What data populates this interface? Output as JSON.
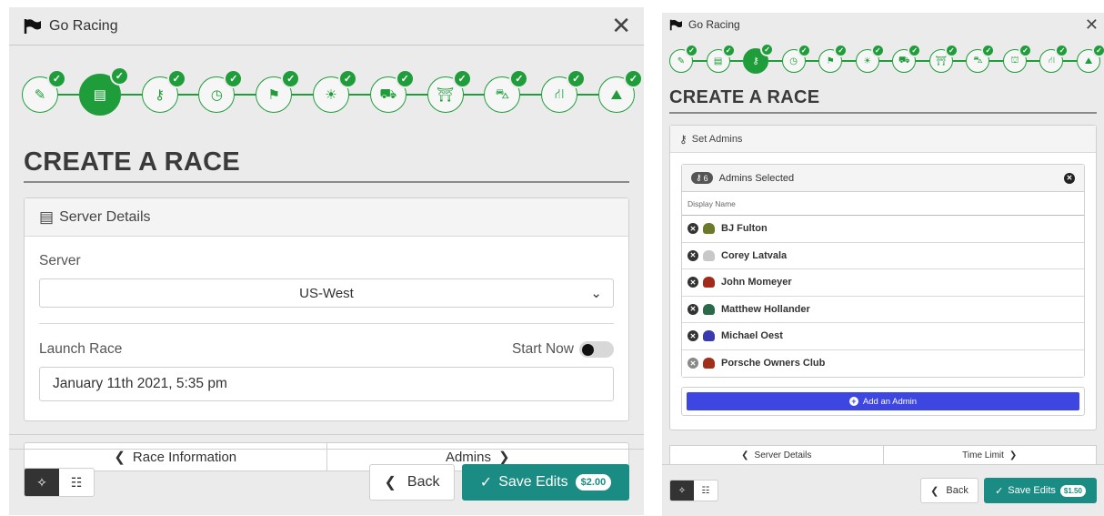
{
  "colors": {
    "green": "#1f9d3a",
    "teal": "#1a8c83",
    "blue": "#3d46e0"
  },
  "left": {
    "app_title": "Go Racing",
    "close": "✕",
    "heading": "CREATE A RACE",
    "card_title": "Server Details",
    "server_label": "Server",
    "server_value": "US-West",
    "launch_label": "Launch Race",
    "start_now_label": "Start Now",
    "start_now_on": false,
    "launch_value": "January 11th 2021, 5:35 pm",
    "nav_prev": "Race Information",
    "nav_next": "Admins",
    "back_label": "Back",
    "save_label": "Save Edits",
    "price": "$2.00",
    "steps": [
      {
        "icon": "pencil-icon",
        "glyph": "✎"
      },
      {
        "icon": "server-icon",
        "glyph": "▤",
        "active": true
      },
      {
        "icon": "key-icon",
        "glyph": "⚷"
      },
      {
        "icon": "clock-icon",
        "glyph": "◷"
      },
      {
        "icon": "flag-icon",
        "glyph": "⚑"
      },
      {
        "icon": "weather-icon",
        "glyph": "☀"
      },
      {
        "icon": "car-icon",
        "glyph": "⛟"
      },
      {
        "icon": "track-icon",
        "glyph": "⛩"
      },
      {
        "icon": "ai-car-icon",
        "glyph": "⛍"
      },
      {
        "icon": "road-icon",
        "glyph": "⛙"
      },
      {
        "icon": "scenery-icon",
        "glyph": "⛰"
      }
    ]
  },
  "right": {
    "app_title": "Go Racing",
    "close": "✕",
    "heading": "CREATE A RACE",
    "card_title": "Set Admins",
    "count": "6",
    "selected_label": "Admins Selected",
    "search_placeholder": "Display Name",
    "admins": [
      {
        "name": "BJ Fulton",
        "helmet": "#6a7a2a"
      },
      {
        "name": "Corey Latvala",
        "helmet": "#c8c8c8"
      },
      {
        "name": "John Momeyer",
        "helmet": "#a22a1a"
      },
      {
        "name": "Matthew Hollander",
        "helmet": "#2a6a4a"
      },
      {
        "name": "Michael Oest",
        "helmet": "#3a3ab0"
      },
      {
        "name": "Porsche Owners Club",
        "helmet": "#a0301a",
        "dim": true
      }
    ],
    "add_label": "Add an Admin",
    "nav_prev": "Server Details",
    "nav_next": "Time Limit",
    "back_label": "Back",
    "save_label": "Save Edits",
    "price": "$1.50",
    "steps": [
      {
        "icon": "pencil-icon",
        "glyph": "✎"
      },
      {
        "icon": "server-icon",
        "glyph": "▤"
      },
      {
        "icon": "key-icon",
        "glyph": "⚷",
        "active": true
      },
      {
        "icon": "clock-icon",
        "glyph": "◷"
      },
      {
        "icon": "flag-icon",
        "glyph": "⚑"
      },
      {
        "icon": "weather-icon",
        "glyph": "☀"
      },
      {
        "icon": "car-icon",
        "glyph": "⛟"
      },
      {
        "icon": "track-icon",
        "glyph": "⛩"
      },
      {
        "icon": "ai-car-icon",
        "glyph": "⛍"
      },
      {
        "icon": "pit-icon",
        "glyph": "⛫"
      },
      {
        "icon": "road-icon",
        "glyph": "⛙"
      },
      {
        "icon": "scenery-icon",
        "glyph": "⛰"
      }
    ]
  }
}
